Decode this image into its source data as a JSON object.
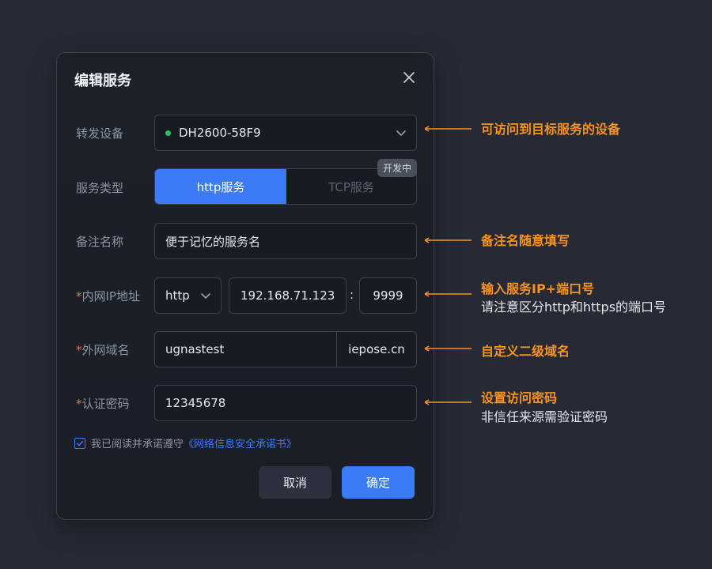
{
  "dialog": {
    "title": "编辑服务",
    "fields": {
      "device": {
        "label": "转发设备",
        "value": "DH2600-58F9"
      },
      "service_type": {
        "label": "服务类型",
        "option_active": "http服务",
        "option_inactive": "TCP服务",
        "badge": "开发中"
      },
      "remark": {
        "label": "备注名称",
        "value": "便于记忆的服务名"
      },
      "intranet": {
        "label": "内网IP地址",
        "required_mark": "*",
        "protocol": "http",
        "ip": "192.168.71.123",
        "separator": ":",
        "port": "9999"
      },
      "domain": {
        "label": "外网域名",
        "required_mark": "*",
        "subdomain": "ugnastest",
        "suffix": "iepose.cn"
      },
      "password": {
        "label": "认证密码",
        "required_mark": "*",
        "value": "12345678"
      }
    },
    "agreement": {
      "text": "我已阅读并承诺遵守",
      "link": "《网络信息安全承诺书》",
      "checked": true
    },
    "buttons": {
      "cancel": "取消",
      "confirm": "确定"
    }
  },
  "annotations": [
    {
      "title": "可访问到目标服务的设备"
    },
    {
      "title": "备注名随意填写"
    },
    {
      "title": "输入服务IP+端口号",
      "subtitle": "请注意区分http和https的端口号"
    },
    {
      "title": "自定义二级域名"
    },
    {
      "title": "设置访问密码",
      "subtitle": "非信任来源需验证密码"
    }
  ],
  "colors": {
    "accent": "#3b7bf6",
    "annotation": "#f7931e",
    "online": "#22c55e",
    "required": "#ff6b4a"
  }
}
